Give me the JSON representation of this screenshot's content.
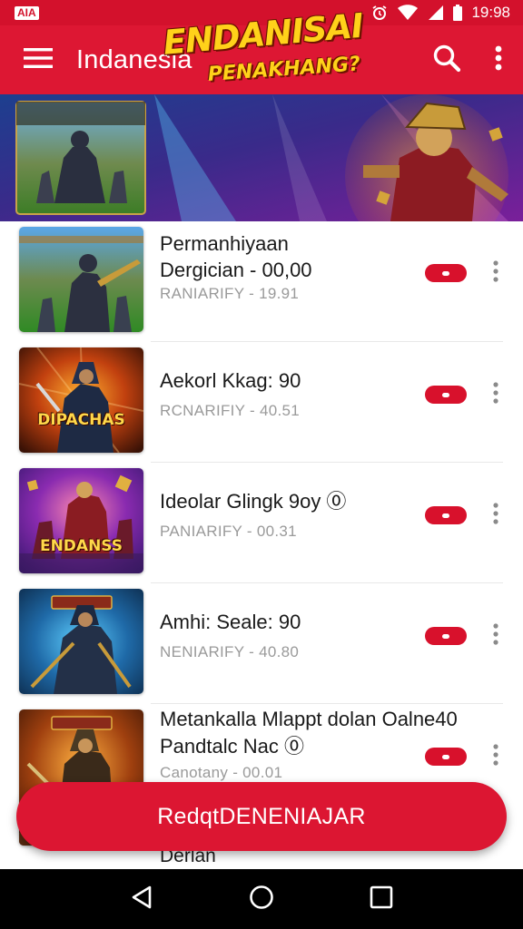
{
  "status_bar": {
    "app_badge": "AIA",
    "time": "19:98"
  },
  "app_bar": {
    "title": "Indanesia"
  },
  "banner": {
    "heading": "ENDANISAI",
    "subheading": "PENAKHANG?",
    "thumb_caption": "ENDANISAI"
  },
  "list": [
    {
      "title": "Permanhiyaan Dergician - 00,00",
      "meta": "RANIARIFY - 19.91",
      "thumb_caption": ""
    },
    {
      "title": "Aekorl Kkag: 90",
      "meta": "RCNARIFIY - 40.51",
      "thumb_caption": "DIPACHAS"
    },
    {
      "title": "Ideolar Glingk 9oy ⓪",
      "meta": "PANIARIFY - 00.31",
      "thumb_caption": "ENDANSS"
    },
    {
      "title": "Amhi: Seale: 90",
      "meta": "NENIARIFY - 40.80",
      "thumb_caption": ""
    },
    {
      "title": "Metankalla Mlappt dolan Oalne40 Pandtalc Nac ⓪",
      "meta": "Canotany - 00.01",
      "thumb_caption": ""
    }
  ],
  "cta": {
    "label": "RedqtDENENIAJAR"
  },
  "peek_item": {
    "title": "Derlan"
  },
  "colors": {
    "primary": "#dd1733",
    "status_bar": "#d3112c",
    "accent": "#d8112c",
    "nav_bar": "#000000"
  },
  "icons": {
    "menu": "hamburger-menu-icon",
    "search": "search-icon",
    "more": "more-vert-icon",
    "nav_back": "nav-back-icon",
    "nav_home": "nav-home-icon",
    "nav_recents": "nav-recents-icon"
  }
}
